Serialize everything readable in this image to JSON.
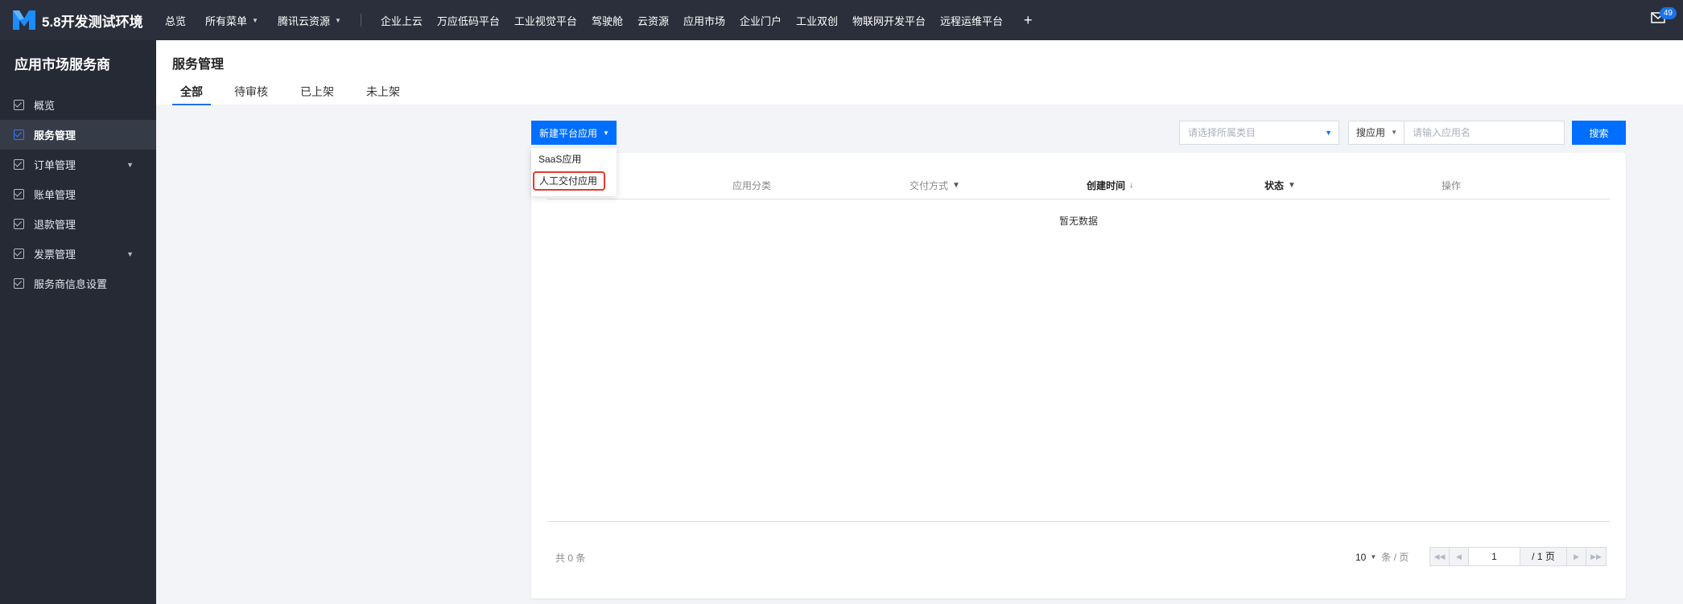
{
  "app": {
    "name": "5.8开发测试环境"
  },
  "topnav": {
    "items": [
      {
        "label": "总览"
      },
      {
        "label": "所有菜单"
      },
      {
        "label": "腾讯云资源"
      },
      {
        "label": "企业上云"
      },
      {
        "label": "万应低码平台"
      },
      {
        "label": "工业视觉平台"
      },
      {
        "label": "驾驶舱"
      },
      {
        "label": "云资源"
      },
      {
        "label": "应用市场"
      },
      {
        "label": "企业门户"
      },
      {
        "label": "工业双创"
      },
      {
        "label": "物联网开发平台"
      },
      {
        "label": "远程运维平台"
      }
    ],
    "plus": "+",
    "mail_badge": "49"
  },
  "sidebar": {
    "title": "应用市场服务商",
    "items": [
      {
        "label": "概览"
      },
      {
        "label": "服务管理"
      },
      {
        "label": "订单管理"
      },
      {
        "label": "账单管理"
      },
      {
        "label": "退款管理"
      },
      {
        "label": "发票管理"
      },
      {
        "label": "服务商信息设置"
      }
    ],
    "active_index": 1
  },
  "header": {
    "title": "服务管理",
    "tabs": [
      {
        "label": "全部"
      },
      {
        "label": "待审核"
      },
      {
        "label": "已上架"
      },
      {
        "label": "未上架"
      }
    ],
    "active_tab": 0
  },
  "toolbar": {
    "new_button": "新建平台应用",
    "dropdown": [
      {
        "label": "SaaS应用"
      },
      {
        "label": "人工交付应用"
      }
    ],
    "category_placeholder": "请选择所属类目",
    "search_type": "搜应用",
    "search_placeholder": "请输入应用名",
    "search_button": "搜索"
  },
  "table": {
    "columns": [
      {
        "label": "应用分类"
      },
      {
        "label": "交付方式"
      },
      {
        "label": "创建时间"
      },
      {
        "label": "状态"
      },
      {
        "label": "操作"
      }
    ],
    "empty_text": "暂无数据",
    "total_text": "共 0 条",
    "page_size": "10",
    "page_size_unit": "条 / 页",
    "current_page": "1",
    "total_pages": "/ 1 页"
  },
  "colors": {
    "topbar": "#2b2f3b",
    "sidebar": "#262a35",
    "accent": "#006eff",
    "highlight": "#e8382c"
  }
}
